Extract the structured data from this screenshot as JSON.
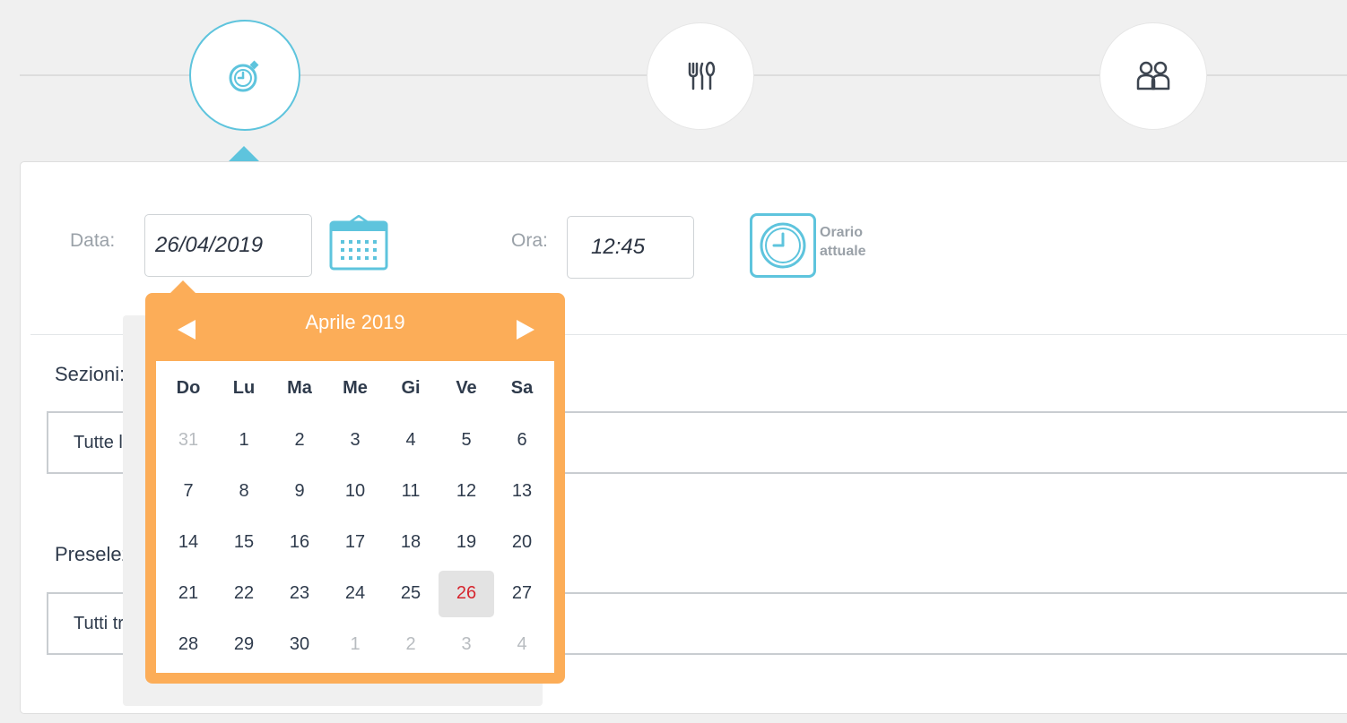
{
  "form": {
    "date_label": "Data:",
    "date_value": "26/04/2019",
    "time_label": "Ora:",
    "time_value": "12:45",
    "now_line1": "Orario",
    "now_line2": "attuale"
  },
  "sections": {
    "label": "Sezioni:",
    "value": "Tutte le"
  },
  "preselection": {
    "label": "Preselez",
    "value": "Tutti tr"
  },
  "datepicker": {
    "title": "Aprile 2019",
    "weekdays": [
      "Do",
      "Lu",
      "Ma",
      "Me",
      "Gi",
      "Ve",
      "Sa"
    ],
    "weeks": [
      [
        {
          "d": "31",
          "m": true
        },
        {
          "d": "1"
        },
        {
          "d": "2"
        },
        {
          "d": "3"
        },
        {
          "d": "4"
        },
        {
          "d": "5"
        },
        {
          "d": "6"
        }
      ],
      [
        {
          "d": "7"
        },
        {
          "d": "8"
        },
        {
          "d": "9"
        },
        {
          "d": "10"
        },
        {
          "d": "11"
        },
        {
          "d": "12"
        },
        {
          "d": "13"
        }
      ],
      [
        {
          "d": "14"
        },
        {
          "d": "15"
        },
        {
          "d": "16"
        },
        {
          "d": "17"
        },
        {
          "d": "18"
        },
        {
          "d": "19"
        },
        {
          "d": "20"
        }
      ],
      [
        {
          "d": "21"
        },
        {
          "d": "22"
        },
        {
          "d": "23"
        },
        {
          "d": "24"
        },
        {
          "d": "25"
        },
        {
          "d": "26",
          "t": true
        },
        {
          "d": "27"
        }
      ],
      [
        {
          "d": "28"
        },
        {
          "d": "29"
        },
        {
          "d": "30"
        },
        {
          "d": "1",
          "m": true
        },
        {
          "d": "2",
          "m": true
        },
        {
          "d": "3",
          "m": true
        },
        {
          "d": "4",
          "m": true
        }
      ]
    ]
  },
  "icons": {
    "step1": "stopwatch-icon",
    "step2": "cutlery-icon",
    "step3": "people-icon",
    "calendar": "calendar-icon",
    "clock": "clock-icon"
  },
  "colors": {
    "accent": "#5ec4dd",
    "picker": "#fcad58",
    "today": "#d6252e"
  }
}
